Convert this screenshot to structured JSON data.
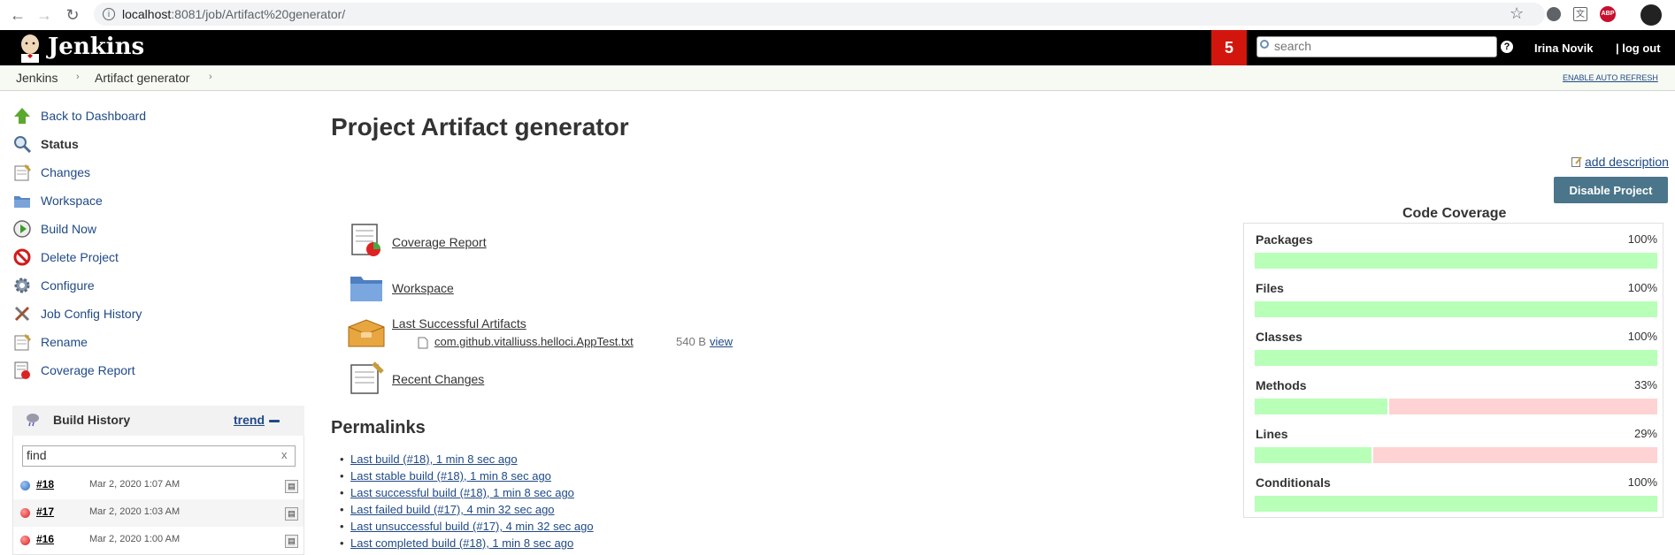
{
  "browser": {
    "url_host": "localhost",
    "url_path": ":8081/job/Artifact%20generator/"
  },
  "header": {
    "logo_text": "Jenkins",
    "notification_count": "5",
    "search_placeholder": "search",
    "user_name": "Irina Novik",
    "logout": "| log out"
  },
  "breadcrumb": {
    "items": [
      "Jenkins",
      "Artifact generator"
    ],
    "auto_refresh": "ENABLE AUTO REFRESH"
  },
  "sidebar": {
    "items": [
      {
        "label": "Back to Dashboard",
        "icon": "up-arrow-icon"
      },
      {
        "label": "Status",
        "icon": "magnifier-icon"
      },
      {
        "label": "Changes",
        "icon": "notepad-icon"
      },
      {
        "label": "Workspace",
        "icon": "folder-icon"
      },
      {
        "label": "Build Now",
        "icon": "clock-play-icon"
      },
      {
        "label": "Delete Project",
        "icon": "no-entry-icon"
      },
      {
        "label": "Configure",
        "icon": "gear-icon"
      },
      {
        "label": "Job Config History",
        "icon": "tools-icon"
      },
      {
        "label": "Rename",
        "icon": "notepad-icon"
      },
      {
        "label": "Coverage Report",
        "icon": "coverage-report-icon"
      }
    ]
  },
  "build_history": {
    "title": "Build History",
    "trend": "trend",
    "find_value": "find",
    "clear": "x",
    "builds": [
      {
        "number": "#18",
        "date": "Mar 2, 2020 1:07 AM",
        "status": "blue"
      },
      {
        "number": "#17",
        "date": "Mar 2, 2020 1:03 AM",
        "status": "red"
      },
      {
        "number": "#16",
        "date": "Mar 2, 2020 1:00 AM",
        "status": "red"
      }
    ]
  },
  "main": {
    "title": "Project Artifact generator",
    "add_description": "add description",
    "disable_button": "Disable Project",
    "links": {
      "coverage_report": "Coverage Report",
      "workspace": "Workspace",
      "last_successful_artifacts": "Last Successful Artifacts",
      "recent_changes": "Recent Changes"
    },
    "artifact": {
      "file": "com.github.vitalliuss.helloci.AppTest.txt",
      "size": "540 B",
      "view": "view"
    },
    "permalinks_title": "Permalinks",
    "permalinks": [
      "Last build (#18), 1 min 8 sec ago",
      "Last stable build (#18), 1 min 8 sec ago",
      "Last successful build (#18), 1 min 8 sec ago",
      "Last failed build (#17), 4 min 32 sec ago",
      "Last unsuccessful build (#17), 4 min 32 sec ago",
      "Last completed build (#18), 1 min 8 sec ago"
    ]
  },
  "coverage": {
    "title": "Code Coverage",
    "metrics": [
      {
        "name": "Packages",
        "percent": "100%",
        "value": 100
      },
      {
        "name": "Files",
        "percent": "100%",
        "value": 100
      },
      {
        "name": "Classes",
        "percent": "100%",
        "value": 100
      },
      {
        "name": "Methods",
        "percent": "33%",
        "value": 33
      },
      {
        "name": "Lines",
        "percent": "29%",
        "value": 29
      },
      {
        "name": "Conditionals",
        "percent": "100%",
        "value": 100
      }
    ],
    "colors": {
      "covered": "#b8ffb8",
      "missed": "#ffd3d3"
    }
  }
}
